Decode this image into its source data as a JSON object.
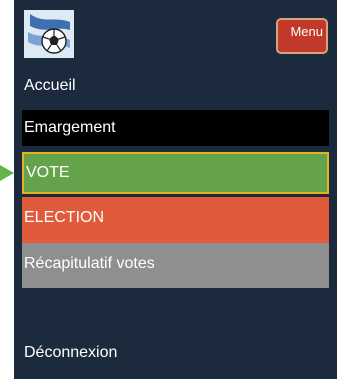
{
  "header": {
    "logo_icon": "soccer-ball-logo",
    "menu_button_label": "Menu"
  },
  "nav": {
    "items": [
      {
        "label": "Accueil"
      },
      {
        "label": "Emargement"
      },
      {
        "label": "VOTE",
        "state": "selected"
      },
      {
        "label": "ELECTION"
      },
      {
        "label": "Récapitulatif votes"
      },
      {
        "label": "Déconnexion"
      }
    ]
  },
  "colors": {
    "sidebar_background": "#1b2a3d",
    "emargement_background": "#000000",
    "vote_background": "#64a34c",
    "vote_highlight_border": "#e6b220",
    "election_background": "#e25a3c",
    "recap_background": "#8f8f8f",
    "menu_button_background": "#c0392b",
    "pointer_arrow": "#64b44c"
  }
}
